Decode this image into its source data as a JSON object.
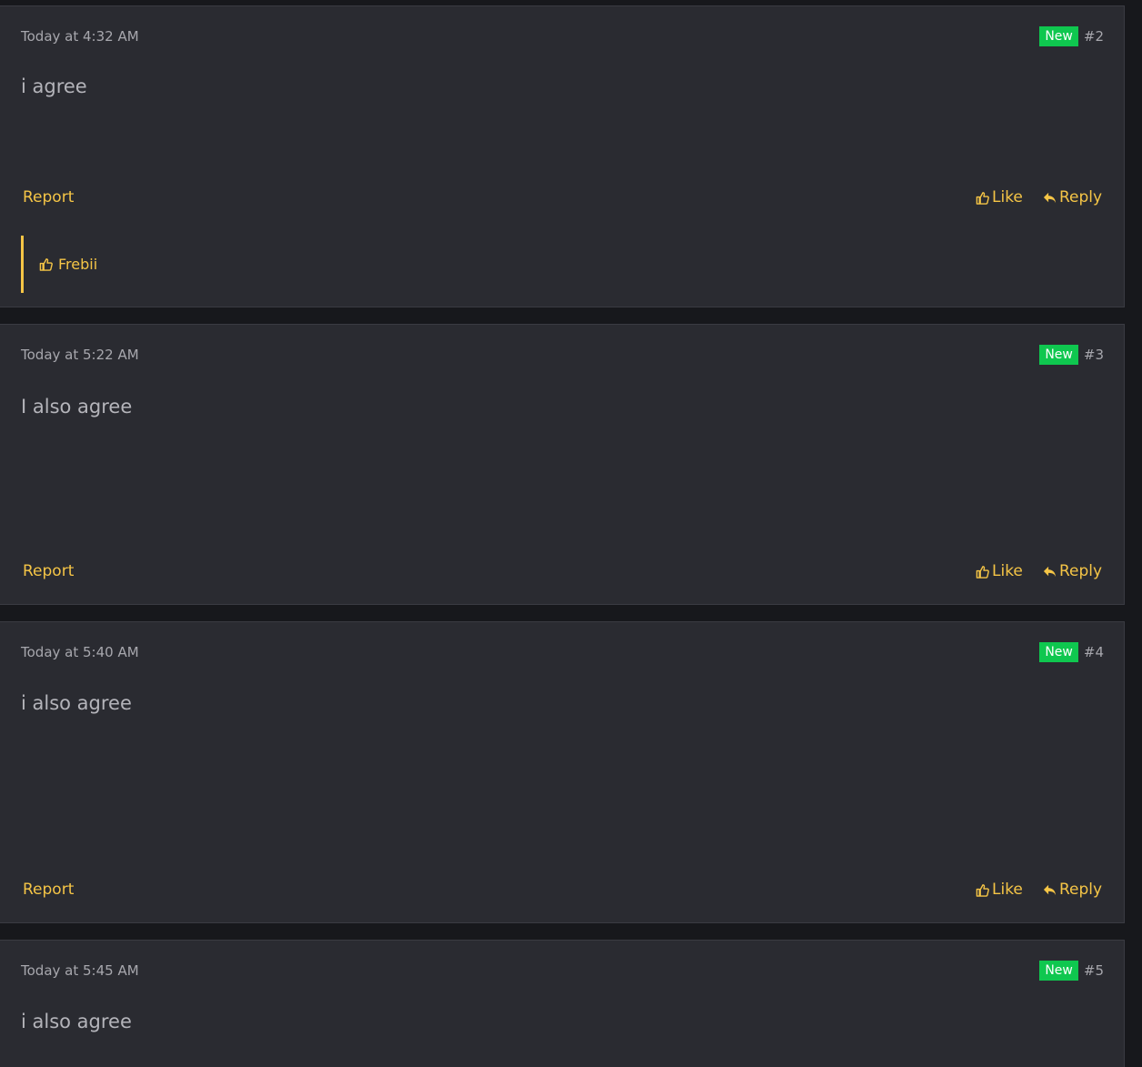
{
  "posts": [
    {
      "date": "Today at 4:32 AM",
      "badge": "New",
      "number": "#2",
      "body": "i agree",
      "report_label": "Report",
      "like_label": "Like",
      "reply_label": "Reply",
      "reaction_user": "Frebii"
    },
    {
      "date": "Today at 5:22 AM",
      "badge": "New",
      "number": "#3",
      "body": "I also agree",
      "report_label": "Report",
      "like_label": "Like",
      "reply_label": "Reply"
    },
    {
      "date": "Today at 5:40 AM",
      "badge": "New",
      "number": "#4",
      "body": "i also agree",
      "report_label": "Report",
      "like_label": "Like",
      "reply_label": "Reply"
    },
    {
      "date": "Today at 5:45 AM",
      "badge": "New",
      "number": "#5",
      "body": "i also agree"
    }
  ],
  "colors": {
    "background": "#17181c",
    "card": "#2a2b31",
    "accent": "#f5c546",
    "new_badge": "#0fc74f",
    "muted_text": "#a7a7ad"
  },
  "icons": {
    "like": "thumbs-up-icon",
    "reply": "reply-arrow-icon"
  }
}
